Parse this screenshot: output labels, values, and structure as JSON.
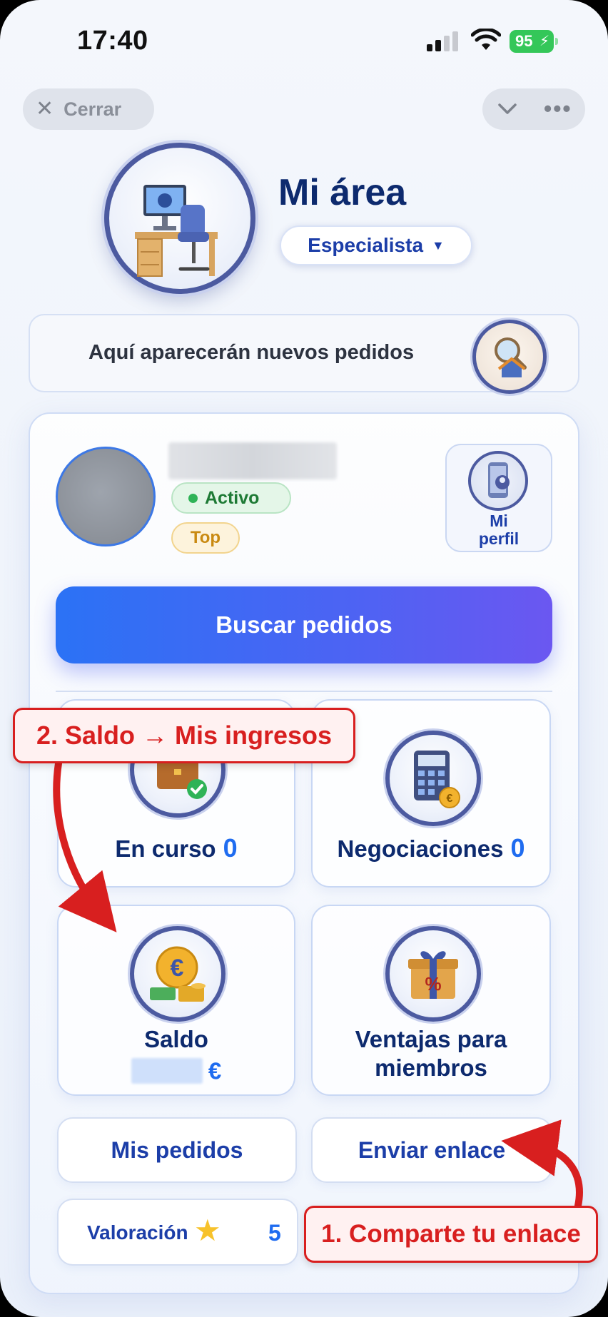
{
  "status_bar": {
    "time": "17:40",
    "battery": "95"
  },
  "top_bar": {
    "close_label": "Cerrar"
  },
  "header": {
    "title": "Mi área",
    "role": "Especialista"
  },
  "banner": {
    "text": "Aquí aparecerán nuevos pedidos"
  },
  "profile": {
    "status": "Activo",
    "badge": "Top",
    "profile_button": "Mi\nperfil"
  },
  "actions": {
    "search": "Buscar pedidos"
  },
  "tiles": {
    "in_progress": {
      "label": "En curso",
      "count": "0"
    },
    "negotiations": {
      "label": "Negociaciones",
      "count": "0"
    },
    "balance": {
      "label": "Saldo",
      "currency": "€"
    },
    "benefits": {
      "label_line1": "Ventajas para",
      "label_line2": "miembros"
    }
  },
  "buttons": {
    "my_orders": "Mis pedidos",
    "send_link": "Enviar enlace",
    "rating_label": "Valoración",
    "rating_value": "5"
  },
  "annotations": {
    "step2": "2. Saldo → Mis ingresos",
    "step1": "1. Comparte tu enlace"
  },
  "colors": {
    "accent": "#1f6cf0",
    "title": "#0d2a6e",
    "annotation": "#d81f1f",
    "active": "#2fb357"
  }
}
